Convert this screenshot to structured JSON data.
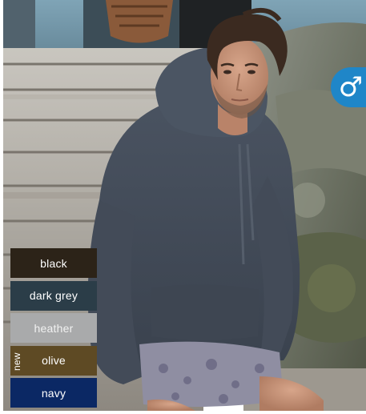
{
  "gender_badge": {
    "symbol": "♂",
    "color": "#1f86c8"
  },
  "swatches": [
    {
      "label": "black",
      "color": "#2c2318",
      "text_color": "#ffffff",
      "new": false
    },
    {
      "label": "dark grey",
      "color": "#2b3d48",
      "text_color": "#ffffff",
      "new": false
    },
    {
      "label": "heather",
      "color": "#a9aaab",
      "text_color": "#f1f1f1",
      "new": false
    },
    {
      "label": "olive",
      "color": "#5e4a24",
      "text_color": "#ffffff",
      "new": true,
      "new_label": "new"
    },
    {
      "label": "navy",
      "color": "#0b2864",
      "text_color": "#ffffff",
      "new": false
    }
  ]
}
